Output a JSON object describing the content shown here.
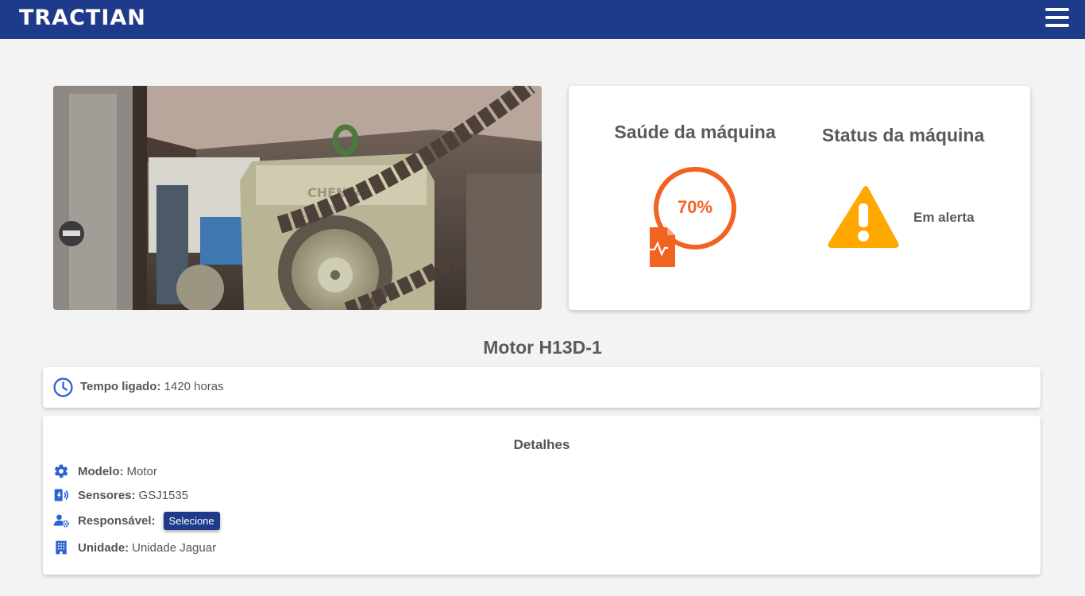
{
  "header": {
    "logo_text": "TRACTIAN",
    "menu_icon": "hamburger-menu-icon",
    "bar_color": "#1e3a8a"
  },
  "status": {
    "health_title": "Saúde da máquina",
    "health_value": "70%",
    "health_fraction": 0.7,
    "status_title": "Status da máquina",
    "status_text": "Em alerta",
    "health_color": "#f26322",
    "alert_color": "#ffa800"
  },
  "machine": {
    "name": "Motor H13D-1"
  },
  "uptime": {
    "label": "Tempo ligado:",
    "value": "1420 horas"
  },
  "details": {
    "title": "Detalhes",
    "model_label": "Modelo:",
    "model_value": "Motor",
    "sensors_label": "Sensores:",
    "sensors_value": "GSJ1535",
    "responsible_label": "Responsável:",
    "responsible_button": "Selecione",
    "unit_label": "Unidade:",
    "unit_value": "Unidade Jaguar"
  }
}
